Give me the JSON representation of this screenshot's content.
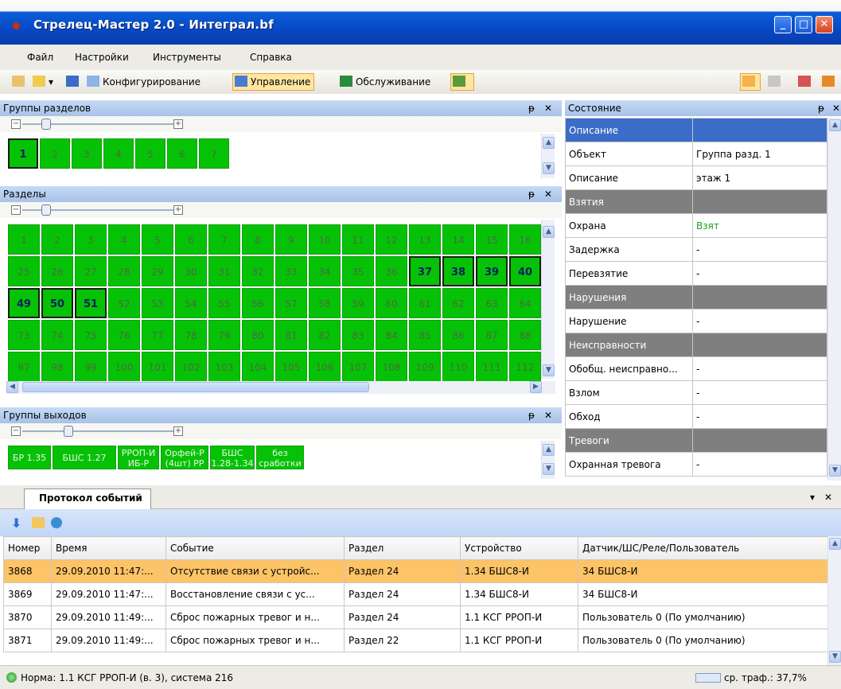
{
  "window": {
    "title": "Стрелец-Мастер 2.0 - Интеграл.bf"
  },
  "menu": [
    "Файл",
    "Настройки",
    "Инструменты",
    "Справка"
  ],
  "toolbar": {
    "config": "Конфигурирование",
    "control": "Управление",
    "service": "Обслуживание"
  },
  "section_groups": {
    "title": "Группы разделов",
    "items": [
      "1",
      "2",
      "3",
      "4",
      "5",
      "6",
      "7"
    ]
  },
  "sections": {
    "title": "Разделы",
    "rows": [
      [
        "1",
        "2",
        "3",
        "4",
        "5",
        "6",
        "7",
        "8",
        "9",
        "10",
        "11",
        "12",
        "13",
        "14",
        "15",
        "16"
      ],
      [
        "25",
        "26",
        "27",
        "28",
        "29",
        "30",
        "31",
        "32",
        "33",
        "34",
        "35",
        "36",
        "37",
        "38",
        "39",
        "40"
      ],
      [
        "49",
        "50",
        "51",
        "52",
        "53",
        "54",
        "55",
        "56",
        "57",
        "58",
        "59",
        "60",
        "61",
        "62",
        "63",
        "64"
      ],
      [
        "73",
        "74",
        "75",
        "76",
        "77",
        "78",
        "79",
        "80",
        "81",
        "82",
        "83",
        "84",
        "85",
        "86",
        "87",
        "88"
      ],
      [
        "97",
        "98",
        "99",
        "100",
        "101",
        "102",
        "103",
        "104",
        "105",
        "106",
        "107",
        "108",
        "109",
        "110",
        "111",
        "112"
      ]
    ]
  },
  "output_groups": {
    "title": "Группы выходов",
    "items": [
      "БР 1.35",
      "БШС 1.27",
      "РРОП-И ИБ-Р",
      "Орфей-Р (4шт) РР",
      "БШС 1.28-1.34",
      "без сработки"
    ]
  },
  "state": {
    "title": "Состояние",
    "rows": [
      {
        "k": "Описание",
        "v": "",
        "sec": "first"
      },
      {
        "k": "Объект",
        "v": "Группа разд. 1"
      },
      {
        "k": "Описание",
        "v": "этаж 1"
      },
      {
        "k": "Взятия",
        "v": "",
        "sec": "yes"
      },
      {
        "k": "Охрана",
        "v": "Взят",
        "green": true
      },
      {
        "k": "Задержка",
        "v": "-"
      },
      {
        "k": "Перевзятие",
        "v": "-"
      },
      {
        "k": "Нарушения",
        "v": "",
        "sec": "yes"
      },
      {
        "k": "Нарушение",
        "v": "-"
      },
      {
        "k": "Неисправности",
        "v": "",
        "sec": "yes"
      },
      {
        "k": "Обобщ. неисправно...",
        "v": "-"
      },
      {
        "k": "Взлом",
        "v": "-"
      },
      {
        "k": "Обход",
        "v": "-"
      },
      {
        "k": "Тревоги",
        "v": "",
        "sec": "yes"
      },
      {
        "k": "Охранная тревога",
        "v": "-"
      }
    ]
  },
  "events": {
    "tab": "Протокол событий",
    "columns": [
      "Номер",
      "Время",
      "Событие",
      "Раздел",
      "Устройство",
      "Датчик/ШС/Реле/Пользователь"
    ],
    "rows": [
      [
        "3868",
        "29.09.2010 11:47:...",
        "Отсутствие связи с устройс...",
        "Раздел 24",
        "1.34 БШС8-И",
        "34 БШС8-И"
      ],
      [
        "3869",
        "29.09.2010 11:47:...",
        "Восстановление связи с ус...",
        "Раздел 24",
        "1.34 БШС8-И",
        "34 БШС8-И"
      ],
      [
        "3870",
        "29.09.2010 11:49:...",
        "Сброс пожарных тревог и н...",
        "Раздел 24",
        "1.1 КСГ РРОП-И",
        "Пользователь 0 (По умолчанию)"
      ],
      [
        "3871",
        "29.09.2010 11:49:...",
        "Сброс пожарных тревог и н...",
        "Раздел 22",
        "1.1 КСГ РРОП-И",
        "Пользователь 0 (По умолчанию)"
      ]
    ]
  },
  "status": {
    "left": "Норма: 1.1 КСГ РРОП-И (в. 3), система 216",
    "right": "ср. траф.: 37,7%"
  }
}
